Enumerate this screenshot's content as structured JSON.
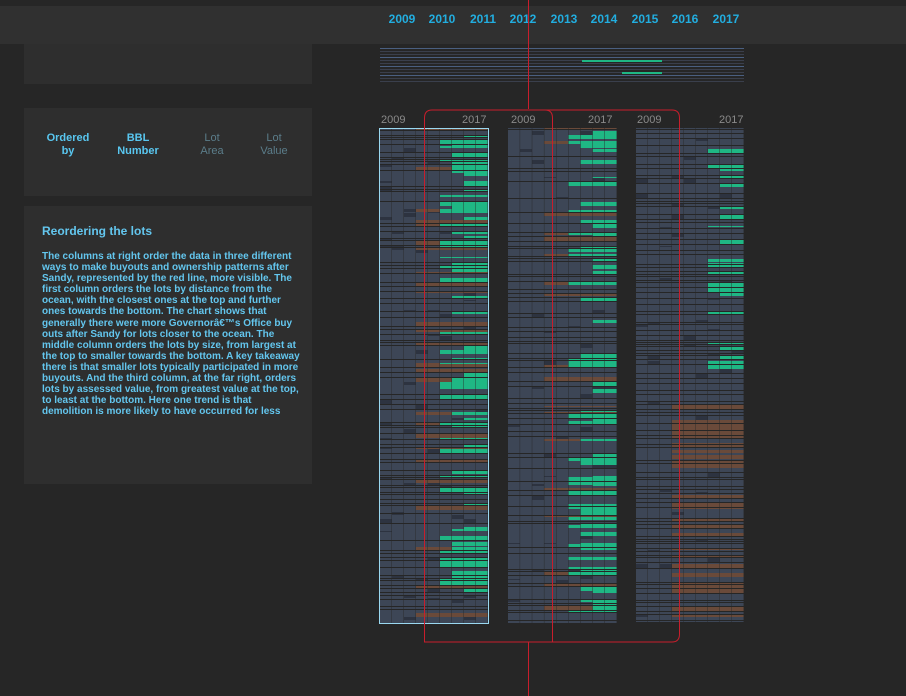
{
  "axis": {
    "years": [
      "2009",
      "2010",
      "2011",
      "2012",
      "2013",
      "2014",
      "2015",
      "2016",
      "2017"
    ]
  },
  "ordering": {
    "label_1": "Ordered",
    "label_2": "by",
    "options": [
      {
        "line1": "BBL",
        "line2": "Number",
        "active": true
      },
      {
        "line1": "Lot",
        "line2": "Area",
        "active": false
      },
      {
        "line1": "Lot",
        "line2": "Value",
        "active": false
      }
    ]
  },
  "text_panel": {
    "title": "Reordering the lots",
    "body": "The columns at right order the data in three different ways to make buyouts and ownership patterns after Sandy, represented by the red line, more visible. The first column orders the lots by distance from the ocean, with the closest ones at the top and further ones towards the bottom. The chart shows that generally there were more Governorâ€™s Office buy outs after Sandy for lots closer to the ocean. The middle column orders the lots by size, from largest at the top to smaller towards the bottom. A key takeaway there is that smaller lots typically participated in more buyouts. And the third column, at the far right, orders lots by assessed value, from greatest value at the top, to least at the bottom. Here one trend is that demolition is more likely to have occurred for less"
  },
  "columns": [
    {
      "start_label": "2009",
      "end_label": "2017",
      "name": "distance-from-ocean"
    },
    {
      "start_label": "2009",
      "end_label": "2017",
      "name": "lot-area"
    },
    {
      "start_label": "2009",
      "end_label": "2017",
      "name": "lot-value"
    }
  ],
  "colors": {
    "accent": "#22aee0",
    "base_lot": "#3d4656",
    "buyout_green": "#1fb784",
    "demolition_brown": "#6a4a3a",
    "sandy_line": "#c81e2c",
    "selection": "#9ad8f0"
  }
}
